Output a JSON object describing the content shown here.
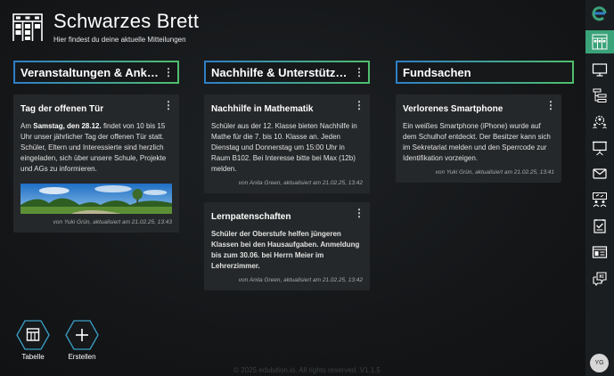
{
  "header": {
    "title": "Schwarzes Brett",
    "subtitle": "Hier findest du deine aktuelle Mitteilungen"
  },
  "columns": [
    {
      "title": "Veranstaltungen & Ankündigungen",
      "cards": [
        {
          "title": "Tag der offenen Tür",
          "body_parts": [
            "Am ",
            "Samstag, den 28.12.",
            " findet von 10 bis 15 Uhr unser jährlicher Tag der offenen Tür statt. Schüler, Eltern und Interessierte sind herzlich eingeladen, sich über unsere Schule, Projekte und AGs zu informieren."
          ],
          "meta": "von Yuki Grün, aktualisiert am 21.02.25, 13:43"
        }
      ]
    },
    {
      "title": "Nachhilfe & Unterstützung",
      "cards": [
        {
          "title": "Nachhilfe in Mathematik",
          "body": "Schüler aus der 12. Klasse bieten Nachhilfe in Mathe für die 7. bis 10. Klasse an. Jeden Dienstag und Donnerstag um 15:00 Uhr in Raum B102. Bei Interesse bitte bei Max (12b) melden.",
          "meta": "von Anita Green, aktualisiert am 21.02.25, 13:42"
        },
        {
          "title": "Lernpatenschaften",
          "body": "Schüler der Oberstufe helfen jüngeren Klassen bei den Hausaufgaben. Anmeldung bis zum 30.06. bei Herrn Meier im Lehrerzimmer.",
          "meta": "von Anita Green, aktualisiert am 21.02.25, 13:42"
        }
      ]
    },
    {
      "title": "Fundsachen",
      "cards": [
        {
          "title": "Verlorenes Smartphone",
          "body": "Ein weißes Smartphone (iPhone) wurde auf dem Schulhof entdeckt. Der Besitzer kann sich im Sekretariat melden und den Sperrcode zur Identifikation vorzeigen.",
          "meta": "von Yuki Grün, aktualisiert am 21.02.25, 13:41"
        }
      ]
    }
  ],
  "actions": [
    {
      "label": "Tabelle",
      "icon": "table-icon"
    },
    {
      "label": "Erstellen",
      "icon": "plus-icon"
    }
  ],
  "footer": "© 2025 edulution.io. All rights reserved. V1.1.5",
  "sidebar": {
    "logo": "edulution-logo",
    "items": [
      "bulletin-board-icon",
      "monitor-icon",
      "org-chart-icon",
      "settings-people-icon",
      "presentation-icon",
      "mail-icon",
      "classroom-icon",
      "survey-icon",
      "dashboard-icon",
      "chat-ki-icon"
    ],
    "active_index": 0,
    "user_initials": "YG"
  },
  "colors": {
    "accent": "#3ba37a",
    "border_start": "#2e7fc7",
    "border_end": "#4fbf6d",
    "card": "#25282a"
  }
}
